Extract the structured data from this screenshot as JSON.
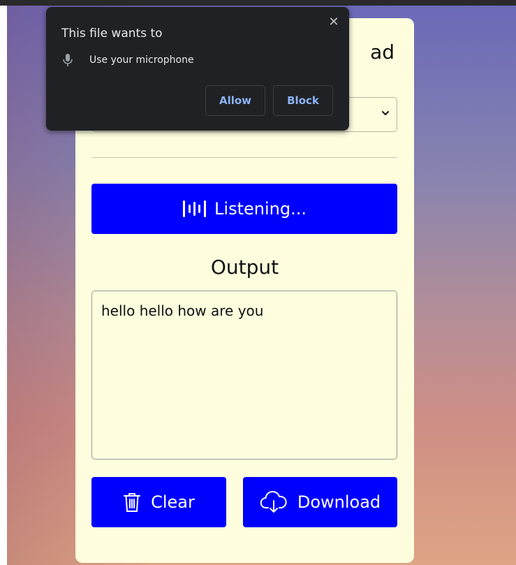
{
  "permission_prompt": {
    "title": "This file wants to",
    "permission_icon": "microphone-icon",
    "permission_text": "Use your microphone",
    "close_label": "✕",
    "allow_label": "Allow",
    "block_label": "Block"
  },
  "card": {
    "title_visible_fragment": "ad",
    "language_select": {
      "selected": ""
    },
    "listen_button": {
      "icon": "audio-waveform-icon",
      "label": "Listening..."
    },
    "output_heading": "Output",
    "output_text": "hello hello how are you",
    "clear_button": {
      "icon": "trash-icon",
      "label": "Clear"
    },
    "download_button": {
      "icon": "cloud-download-icon",
      "label": "Download"
    }
  },
  "colors": {
    "primary": "#0000ff",
    "card_background": "#fefdde",
    "popup_background": "#202124",
    "popup_button_text": "#8ab4f8"
  }
}
